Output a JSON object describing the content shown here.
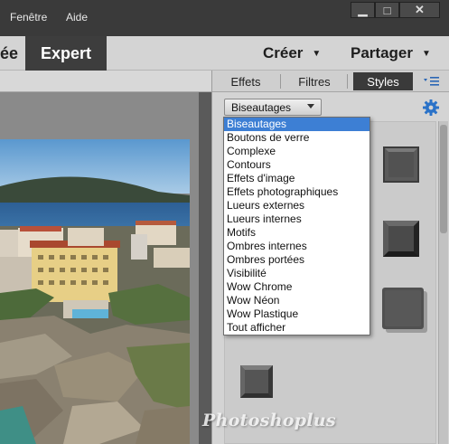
{
  "menubar": {
    "items": [
      {
        "label": "Fenêtre"
      },
      {
        "label": "Aide"
      }
    ],
    "window_controls": {
      "minimize": "▁",
      "maximize": "□",
      "close": "✕"
    }
  },
  "modebar": {
    "partial_tab": "ée",
    "active_tab": "Expert",
    "actions": [
      {
        "label": "Créer",
        "caret": "▼"
      },
      {
        "label": "Partager",
        "caret": "▼"
      }
    ]
  },
  "panel": {
    "tabs": [
      {
        "label": "Effets"
      },
      {
        "label": "Filtres"
      },
      {
        "label": "Styles",
        "active": true
      }
    ],
    "menu_icon": "panel-menu-icon",
    "category_select": {
      "value": "Biseautages"
    },
    "dropdown_options": [
      "Biseautages",
      "Boutons de verre",
      "Complexe",
      "Contours",
      "Effets d'image",
      "Effets photographiques",
      "Lueurs externes",
      "Lueurs internes",
      "Motifs",
      "Ombres internes",
      "Ombres portées",
      "Visibilité",
      "Wow Chrome",
      "Wow Néon",
      "Wow Plastique",
      "Tout afficher"
    ],
    "selected_index": 0
  },
  "watermark": "Photoshoplus",
  "colors": {
    "accent_selection": "#3d7fd4",
    "active_tab_bg": "#3d3d3d",
    "gear_icon": "#2a72c8"
  }
}
